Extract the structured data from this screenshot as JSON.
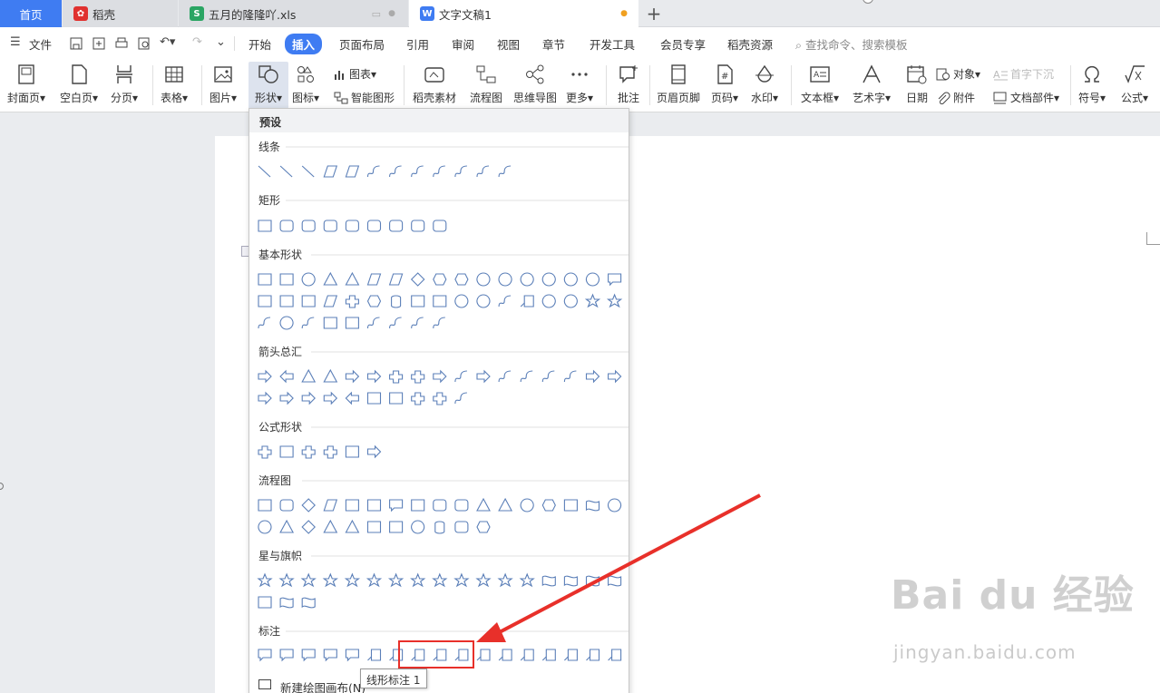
{
  "tabs": {
    "home": "首页",
    "docer": "稻壳",
    "xls": "五月的隆隆吖.xls",
    "doc": "文字文稿1",
    "add": "+"
  },
  "menu": {
    "file": "文件",
    "items": [
      "开始",
      "插入",
      "页面布局",
      "引用",
      "审阅",
      "视图",
      "章节",
      "开发工具",
      "会员专享",
      "稻壳资源"
    ],
    "active": "插入",
    "search": "查找命令、搜索模板"
  },
  "ribbon": {
    "cover": "封面页▾",
    "blank": "空白页▾",
    "break": "分页▾",
    "table": "表格▾",
    "picture": "图片▾",
    "shape": "形状▾",
    "icon": "图标▾",
    "chart": "图表▾",
    "smart": "智能图形",
    "material": "稻壳素材",
    "flow": "流程图",
    "mind": "思维导图",
    "more": "更多▾",
    "comment": "批注",
    "header": "页眉页脚",
    "pageno": "页码▾",
    "watermark": "水印▾",
    "textbox": "文本框▾",
    "wordart": "艺术字▾",
    "date": "日期",
    "object": "对象▾",
    "dropcap": "首字下沉",
    "attach": "附件",
    "docpart": "文档部件▾",
    "symbol": "符号▾",
    "formula": "公式▾"
  },
  "shapes_panel": {
    "header": "预设",
    "sections": [
      "线条",
      "矩形",
      "基本形状",
      "箭头总汇",
      "公式形状",
      "流程图",
      "星与旗帜",
      "标注"
    ],
    "tooltip": "线形标注 1",
    "new_canvas": "新建绘图画布(N)"
  },
  "watermark": {
    "logo": "Bai du 经验",
    "url": "jingyan.baidu.com"
  },
  "colors": {
    "accent": "#3f7cf2",
    "highlight": "#e8302a",
    "shape_stroke": "#5b7fb8"
  }
}
